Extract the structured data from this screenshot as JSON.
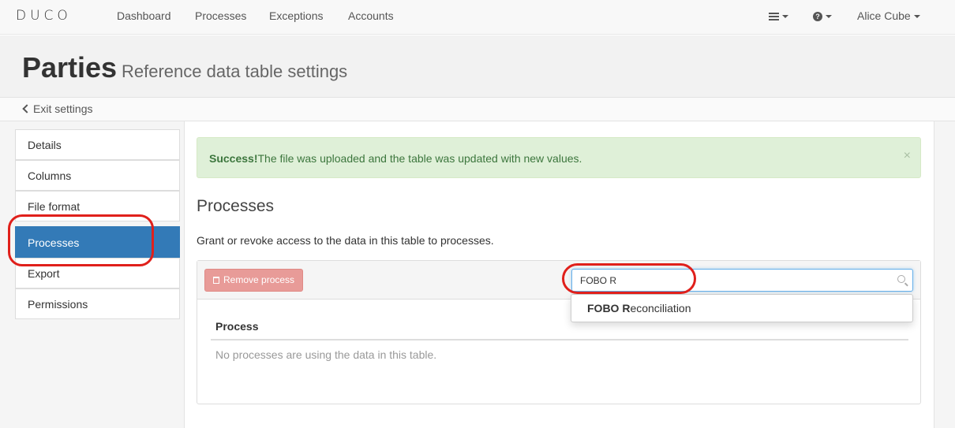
{
  "navbar": {
    "logo": "DUCO",
    "links": [
      "Dashboard",
      "Processes",
      "Exceptions",
      "Accounts"
    ],
    "user_name": "Alice Cube",
    "menu_icon": "hamburger-icon",
    "help_icon": "question-circle-icon"
  },
  "header": {
    "title": "Parties",
    "subtitle": "Reference data table settings"
  },
  "exit_link": "Exit settings",
  "sidebar": {
    "items": [
      {
        "label": "Details"
      },
      {
        "label": "Columns"
      },
      {
        "label": "File format"
      },
      {
        "label": "Processes",
        "active": true
      },
      {
        "label": "Export"
      },
      {
        "label": "Permissions"
      }
    ]
  },
  "alert": {
    "strong": "Success!",
    "message": "The file was uploaded and the table was updated with new values.",
    "close": "×"
  },
  "section": {
    "title": "Processes",
    "description": "Grant or revoke access to the data in this table to processes."
  },
  "toolbar": {
    "remove_label": "Remove process"
  },
  "search": {
    "value": "FOBO R"
  },
  "suggestion": {
    "match": "FOBO R",
    "rest": "econciliation"
  },
  "table": {
    "column": "Process",
    "empty_message": "No processes are using the data in this table."
  },
  "colors": {
    "active": "#337ab7",
    "success_bg": "#dff0d8",
    "danger": "#e89b98",
    "annotation": "#e0201b"
  }
}
